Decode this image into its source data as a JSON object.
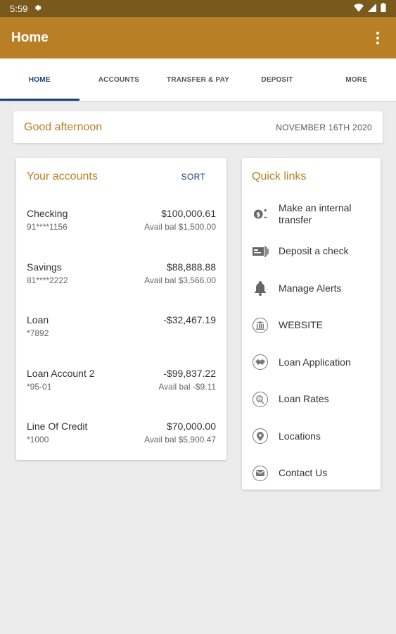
{
  "status": {
    "time": "5:59"
  },
  "appbar": {
    "title": "Home"
  },
  "tabs": [
    {
      "label": "HOME",
      "active": true
    },
    {
      "label": "ACCOUNTS"
    },
    {
      "label": "TRANSFER & PAY"
    },
    {
      "label": "DEPOSIT"
    },
    {
      "label": "MORE"
    }
  ],
  "greeting": {
    "text": "Good afternoon",
    "date": "NOVEMBER 16TH 2020"
  },
  "accounts": {
    "title": "Your accounts",
    "sort_label": "SORT",
    "items": [
      {
        "name": "Checking",
        "number": "91****1156",
        "balance": "$100,000.61",
        "available": "Avail bal $1,500.00"
      },
      {
        "name": "Savings",
        "number": "81****2222",
        "balance": "$88,888.88",
        "available": "Avail bal $3,566.00"
      },
      {
        "name": "Loan",
        "number": "*7892",
        "balance": "-$32,467.19",
        "available": ""
      },
      {
        "name": "Loan Account 2",
        "number": "*95-01",
        "balance": "-$99,837.22",
        "available": "Avail bal -$9.11"
      },
      {
        "name": "Line Of Credit",
        "number": "*1000",
        "balance": "$70,000.00",
        "available": "Avail bal $5,900.47"
      }
    ]
  },
  "quick_links": {
    "title": "Quick links",
    "items": [
      {
        "label": "Make an internal transfer",
        "icon": "transfer-icon"
      },
      {
        "label": "Deposit a check",
        "icon": "check-deposit-icon"
      },
      {
        "label": "Manage Alerts",
        "icon": "bell-icon"
      },
      {
        "label": "WEBSITE",
        "icon": "bank-icon"
      },
      {
        "label": "Loan Application",
        "icon": "handshake-icon"
      },
      {
        "label": "Loan Rates",
        "icon": "rates-icon"
      },
      {
        "label": "Locations",
        "icon": "location-pin-icon"
      },
      {
        "label": "Contact Us",
        "icon": "mail-icon"
      }
    ]
  },
  "colors": {
    "appbar": "#b87f24",
    "statusbar": "#7a5a1c",
    "accent_text": "#b87f24",
    "tab_active": "#1d3f7a"
  }
}
